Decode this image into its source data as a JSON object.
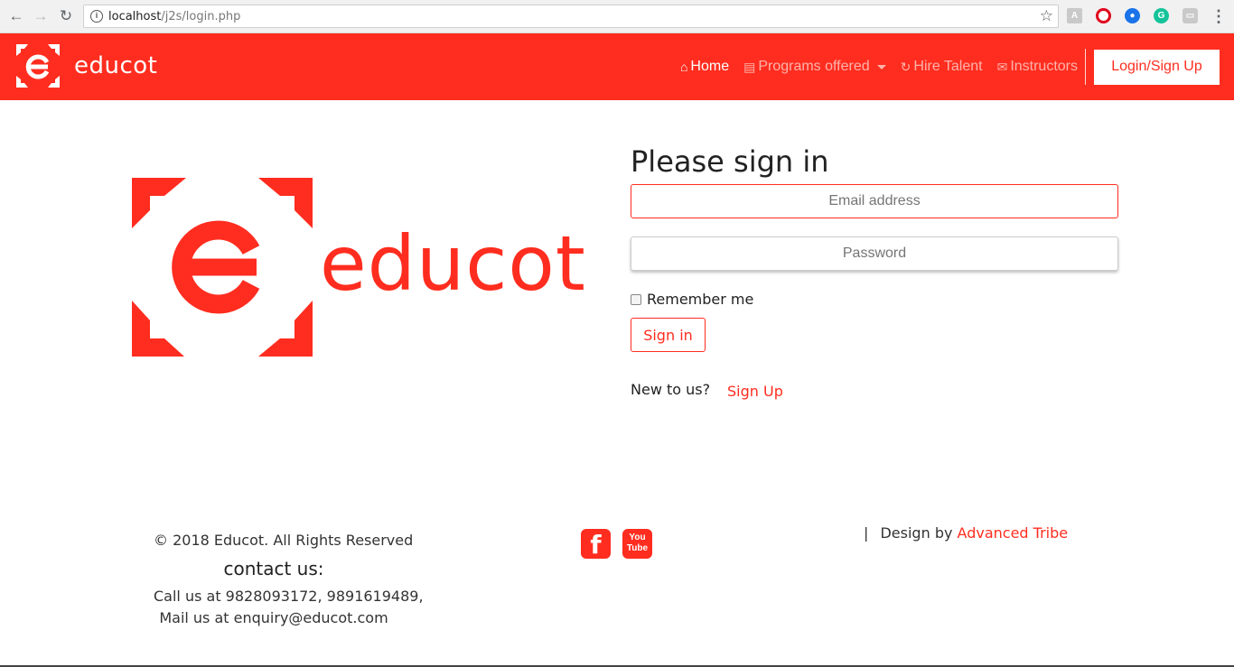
{
  "browser": {
    "url_host": "localhost",
    "url_path": "/j2s/login.php",
    "back_icon": "arrow-left-icon",
    "forward_icon": "arrow-right-icon",
    "reload_icon": "reload-icon",
    "info_icon": "info-icon",
    "bookmark_icon": "star-icon",
    "menu_icon": "kebab-menu-icon"
  },
  "navbar": {
    "brand_name": "educot",
    "home_label": "Home",
    "programs_label": "Programs offered",
    "hire_label": "Hire Talent",
    "instructors_label": "Instructors",
    "login_label": "Login/Sign Up",
    "background_color": "#ff2d1f"
  },
  "hero": {
    "logo_word": "educot"
  },
  "signin": {
    "title": "Please sign in",
    "email_placeholder": "Email address",
    "password_placeholder": "Password",
    "remember_label": "Remember me",
    "button_label": "Sign in",
    "new_to_us": "New to us?",
    "signup_link": "Sign Up"
  },
  "footer": {
    "copyright": "© 2018 Educot. All Rights Reserved",
    "contact_title": "contact us:",
    "call": "Call us at 9828093172, 9891619489,",
    "mail": "Mail us at enquiry@educot.com",
    "facebook_icon": "facebook-icon",
    "youtube_icon": "youtube-icon",
    "design_sep": "|",
    "design_prefix": "Design by",
    "design_link": "Advanced Tribe"
  },
  "colors": {
    "accent": "#ff2d1f",
    "nav_inactive": "#ffb3ab"
  }
}
